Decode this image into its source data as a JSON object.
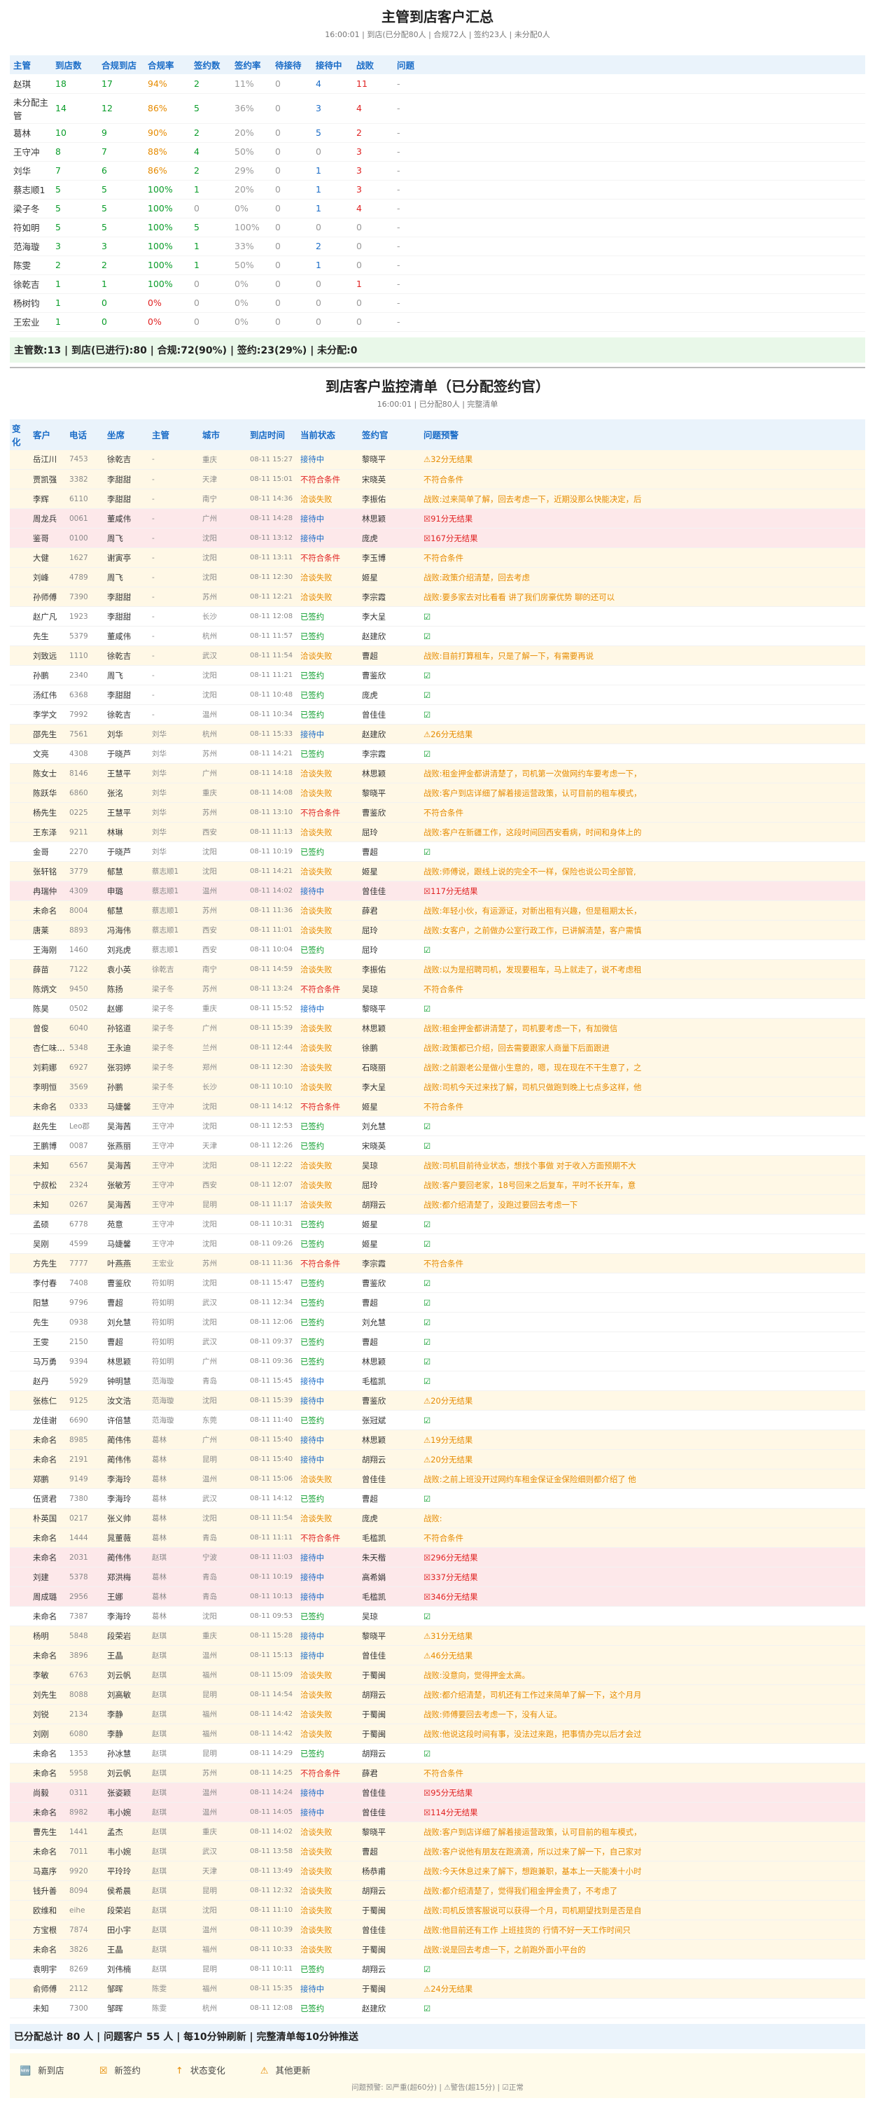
{
  "title": "主管到店客户汇总",
  "subtitle": "16:00:01 | 到店(已分配80人 | 合规72人 | 签约23人 | 未分配0人",
  "mgr_headers": [
    "主管",
    "到店数",
    "合规到店",
    "合规率",
    "签约数",
    "签约率",
    "待接待",
    "接待中",
    "战败",
    "问题"
  ],
  "managers": [
    [
      "赵琪",
      "18",
      "17",
      "94%",
      "2",
      "11%",
      "0",
      "4",
      "11",
      "-"
    ],
    [
      "未分配主管",
      "14",
      "12",
      "86%",
      "5",
      "36%",
      "0",
      "3",
      "4",
      "-"
    ],
    [
      "葛林",
      "10",
      "9",
      "90%",
      "2",
      "20%",
      "0",
      "5",
      "2",
      "-"
    ],
    [
      "王守冲",
      "8",
      "7",
      "88%",
      "4",
      "50%",
      "0",
      "0",
      "3",
      "-"
    ],
    [
      "刘华",
      "7",
      "6",
      "86%",
      "2",
      "29%",
      "0",
      "1",
      "3",
      "-"
    ],
    [
      "蔡志顺1",
      "5",
      "5",
      "100%",
      "1",
      "20%",
      "0",
      "1",
      "3",
      "-"
    ],
    [
      "梁子冬",
      "5",
      "5",
      "100%",
      "0",
      "0%",
      "0",
      "1",
      "4",
      "-"
    ],
    [
      "符如明",
      "5",
      "5",
      "100%",
      "5",
      "100%",
      "0",
      "0",
      "0",
      "-"
    ],
    [
      "范海璇",
      "3",
      "3",
      "100%",
      "1",
      "33%",
      "0",
      "2",
      "0",
      "-"
    ],
    [
      "陈雯",
      "2",
      "2",
      "100%",
      "1",
      "50%",
      "0",
      "1",
      "0",
      "-"
    ],
    [
      "徐乾吉",
      "1",
      "1",
      "100%",
      "0",
      "0%",
      "0",
      "0",
      "1",
      "-"
    ],
    [
      "杨树钧",
      "1",
      "0",
      "0%",
      "0",
      "0%",
      "0",
      "0",
      "0",
      "-"
    ],
    [
      "王宏业",
      "1",
      "0",
      "0%",
      "0",
      "0%",
      "0",
      "0",
      "0",
      "-"
    ]
  ],
  "mgr_note": "主管数:13 | 到店(已进行):80 | 合规:72(90%) | 签约:23(29%) | 未分配:0",
  "title2": "到店客户监控清单（已分配签约官）",
  "subtitle2": "16:00:01 | 已分配80人 | 完整清单",
  "mon_headers": [
    "变化",
    "客户",
    "电话",
    "坐席",
    "主管",
    "城市",
    "到店时间",
    "当前状态",
    "签约官",
    "问题预警"
  ],
  "rows": [
    [
      "岳江川",
      "7453",
      "徐乾吉",
      "-",
      "重庆",
      "08-11 15:27",
      "接待中",
      "黎晓平",
      "⚠32分无结果",
      "c"
    ],
    [
      "贾凯强",
      "3382",
      "李甜甜",
      "-",
      "天津",
      "08-11 15:01",
      "不符合条件",
      "宋晓英",
      "不符合条件",
      "c"
    ],
    [
      "李辉",
      "6110",
      "李甜甜",
      "-",
      "南宁",
      "08-11 14:36",
      "洽谈失败",
      "李振佑",
      "战败:过来简单了解，回去考虑一下，近期没那么快能决定，后",
      "c"
    ],
    [
      "周龙兵",
      "0061",
      "董咸伟",
      "-",
      "广州",
      "08-11 14:28",
      "接待中",
      "林思颖",
      "☒91分无结果",
      "r"
    ],
    [
      "鉴哥",
      "0100",
      "周飞",
      "-",
      "沈阳",
      "08-11 13:12",
      "接待中",
      "庞虎",
      "☒167分无结果",
      "r"
    ],
    [
      "大健",
      "1627",
      "谢寅亭",
      "-",
      "沈阳",
      "08-11 13:11",
      "不符合条件",
      "李玉博",
      "不符合条件",
      "c"
    ],
    [
      "刘峰",
      "4789",
      "周飞",
      "-",
      "沈阳",
      "08-11 12:30",
      "洽谈失败",
      "姬星",
      "战败:政策介绍清楚，回去考虑",
      "c"
    ],
    [
      "孙师傅",
      "7390",
      "李甜甜",
      "-",
      "苏州",
      "08-11 12:21",
      "洽谈失败",
      "李宗霞",
      "战败:要多家去对比看看 讲了我们房豪优势 聊的还可以",
      "c"
    ],
    [
      "赵广凡",
      "1923",
      "李甜甜",
      "-",
      "长沙",
      "08-11 12:08",
      "已签约",
      "李大呈",
      "☑",
      "n"
    ],
    [
      "先生",
      "5379",
      "董咸伟",
      "-",
      "杭州",
      "08-11 11:57",
      "已签约",
      "赵建欣",
      "☑",
      "n"
    ],
    [
      "刘致远",
      "1110",
      "徐乾吉",
      "-",
      "武汉",
      "08-11 11:54",
      "洽谈失败",
      "曹超",
      "战败:目前打算租车，只是了解一下，有需要再说",
      "c"
    ],
    [
      "孙鹏",
      "2340",
      "周飞",
      "-",
      "沈阳",
      "08-11 11:21",
      "已签约",
      "曹鉴欣",
      "☑",
      "n"
    ],
    [
      "汤红伟",
      "6368",
      "李甜甜",
      "-",
      "沈阳",
      "08-11 10:48",
      "已签约",
      "庞虎",
      "☑",
      "n"
    ],
    [
      "李学文",
      "7992",
      "徐乾吉",
      "-",
      "温州",
      "08-11 10:34",
      "已签约",
      "曾佳佳",
      "☑",
      "n"
    ],
    [
      "邵先生",
      "7561",
      "刘华",
      "刘华",
      "杭州",
      "08-11 15:33",
      "接待中",
      "赵建欣",
      "⚠26分无结果",
      "c"
    ],
    [
      "文亮",
      "4308",
      "于晓芦",
      "刘华",
      "苏州",
      "08-11 14:21",
      "已签约",
      "李宗霞",
      "☑",
      "n"
    ],
    [
      "陈女士",
      "8146",
      "王慧平",
      "刘华",
      "广州",
      "08-11 14:18",
      "洽谈失败",
      "林思颖",
      "战败:租金押金都讲清楚了，司机第一次做网约车要考虑一下，",
      "c"
    ],
    [
      "陈跃华",
      "6860",
      "张洺",
      "刘华",
      "重庆",
      "08-11 14:08",
      "洽谈失败",
      "黎晓平",
      "战败:客户到店详细了解着接运营政策，认可目前的租车模式，",
      "c"
    ],
    [
      "杨先生",
      "0225",
      "王慧平",
      "刘华",
      "苏州",
      "08-11 13:10",
      "不符合条件",
      "曹鉴欣",
      "不符合条件",
      "c"
    ],
    [
      "王东泽",
      "9211",
      "林琳",
      "刘华",
      "西安",
      "08-11 11:13",
      "洽谈失败",
      "屈玲",
      "战败:客户在新疆工作，这段时间回西安看病，时间和身体上的",
      "c"
    ],
    [
      "金哥",
      "2270",
      "于晓芦",
      "刘华",
      "沈阳",
      "08-11 10:19",
      "已签约",
      "曹超",
      "☑",
      "n"
    ],
    [
      "张轩铭",
      "3779",
      "郁慧",
      "蔡志顺1",
      "沈阳",
      "08-11 14:21",
      "洽谈失败",
      "姬星",
      "战败:师傅说，跟线上说的完全不一样，保险也说公司全部管,",
      "c"
    ],
    [
      "冉瑞仲",
      "4309",
      "申璐",
      "蔡志顺1",
      "温州",
      "08-11 14:02",
      "接待中",
      "曾佳佳",
      "☒117分无结果",
      "r"
    ],
    [
      "未命名",
      "8004",
      "郁慧",
      "蔡志顺1",
      "苏州",
      "08-11 11:36",
      "洽谈失败",
      "薛君",
      "战败:年轻小伙，有运源证，对新出租有兴趣，但是租期太长，",
      "c"
    ],
    [
      "唐莱",
      "8893",
      "冯海伟",
      "蔡志顺1",
      "西安",
      "08-11 11:01",
      "洽谈失败",
      "屈玲",
      "战败:女客户，之前做办公室行政工作，已讲解清楚，客户需慎",
      "c"
    ],
    [
      "王海刚",
      "1460",
      "刘兆虎",
      "蔡志顺1",
      "西安",
      "08-11 10:04",
      "已签约",
      "屈玲",
      "☑",
      "n"
    ],
    [
      "薛苗",
      "7122",
      "袁小英",
      "徐乾吉",
      "南宁",
      "08-11 14:59",
      "洽谈失败",
      "李振佑",
      "战败:以为是招聘司机，发现要租车，马上就走了，说不考虑租",
      "c"
    ],
    [
      "陈炳文",
      "9450",
      "陈扬",
      "梁子冬",
      "苏州",
      "08-11 13:24",
      "不符合条件",
      "吴琼",
      "不符合条件",
      "c"
    ],
    [
      "陈昊",
      "0502",
      "赵娜",
      "梁子冬",
      "重庆",
      "08-11 15:52",
      "接待中",
      "黎晓平",
      "☑",
      "n"
    ],
    [
      "曾俊",
      "6040",
      "孙铭道",
      "梁子冬",
      "广州",
      "08-11 15:39",
      "洽谈失败",
      "林思颖",
      "战败:租金押金都讲清楚了，司机要考虑一下，有加微信",
      "c"
    ],
    [
      "杏仁味的馨馨",
      "5348",
      "王永迪",
      "梁子冬",
      "兰州",
      "08-11 12:44",
      "洽谈失败",
      "徐鹏",
      "战败:政策都已介绍，回去需要跟家人商量下后面跟进",
      "c"
    ],
    [
      "刘莉娜",
      "6927",
      "张羽婷",
      "梁子冬",
      "郑州",
      "08-11 12:30",
      "洽谈失败",
      "石晓丽",
      "战败:之前跟老公是做小生意的，嗯，现在现在不干生意了，之",
      "c"
    ],
    [
      "李明恒",
      "3569",
      "孙鹏",
      "梁子冬",
      "长沙",
      "08-11 10:10",
      "洽谈失败",
      "李大呈",
      "战败:司机今天过来找了解，司机只做跑到晚上七点多这样，他",
      "c"
    ],
    [
      "未命名",
      "0333",
      "马婕馨",
      "王守冲",
      "沈阳",
      "08-11 14:12",
      "不符合条件",
      "姬星",
      "不符合条件",
      "c"
    ],
    [
      "赵先生",
      "Leo郡",
      "吴海茜",
      "王守冲",
      "沈阳",
      "08-11 12:53",
      "已签约",
      "刘允慧",
      "☑",
      "n"
    ],
    [
      "王鹏博",
      "0087",
      "张燕丽",
      "王守冲",
      "天津",
      "08-11 12:26",
      "已签约",
      "宋晓英",
      "☑",
      "n"
    ],
    [
      "未知",
      "6567",
      "吴海茜",
      "王守冲",
      "沈阳",
      "08-11 12:22",
      "洽谈失败",
      "吴琼",
      "战败:司机目前待业状态，想找个事做 对于收入方面预期不大",
      "c"
    ],
    [
      "宁叔松",
      "2324",
      "张敏芳",
      "王守冲",
      "西安",
      "08-11 12:07",
      "洽谈失败",
      "屈玲",
      "战败:客户要回老家，18号回来之后复车，平时不长开车，意",
      "c"
    ],
    [
      "未知",
      "0267",
      "吴海茜",
      "王守冲",
      "昆明",
      "08-11 11:17",
      "洽谈失败",
      "胡翔云",
      "战败:都介绍清楚了，没跑过要回去考虑一下",
      "c"
    ],
    [
      "孟硕",
      "6778",
      "苑意",
      "王守冲",
      "沈阳",
      "08-11 10:31",
      "已签约",
      "姬星",
      "☑",
      "n"
    ],
    [
      "吴刚",
      "4599",
      "马婕馨",
      "王守冲",
      "沈阳",
      "08-11 09:26",
      "已签约",
      "姬星",
      "☑",
      "n"
    ],
    [
      "方先生",
      "7777",
      "叶燕燕",
      "王宏业",
      "苏州",
      "08-11 11:36",
      "不符合条件",
      "李宗霞",
      "不符合条件",
      "c"
    ],
    [
      "李付春",
      "7408",
      "曹鉴欣",
      "符如明",
      "沈阳",
      "08-11 15:47",
      "已签约",
      "曹鉴欣",
      "☑",
      "n"
    ],
    [
      "阳慧",
      "9796",
      "曹超",
      "符如明",
      "武汉",
      "08-11 12:34",
      "已签约",
      "曹超",
      "☑",
      "n"
    ],
    [
      "先生",
      "0938",
      "刘允慧",
      "符如明",
      "沈阳",
      "08-11 12:06",
      "已签约",
      "刘允慧",
      "☑",
      "n"
    ],
    [
      "王雯",
      "2150",
      "曹超",
      "符如明",
      "武汉",
      "08-11 09:37",
      "已签约",
      "曹超",
      "☑",
      "n"
    ],
    [
      "马万勇",
      "9394",
      "林思颖",
      "符如明",
      "广州",
      "08-11 09:36",
      "已签约",
      "林思颖",
      "☑",
      "n"
    ],
    [
      "赵丹",
      "5929",
      "钟明慧",
      "范海璇",
      "青岛",
      "08-11 15:45",
      "接待中",
      "毛槛凯",
      "☑",
      "n"
    ],
    [
      "张栋仁",
      "9125",
      "汝文浩",
      "范海璇",
      "沈阳",
      "08-11 15:39",
      "接待中",
      "曹鉴欣",
      "⚠20分无结果",
      "c"
    ],
    [
      "龙佳谢",
      "6690",
      "许倍慧",
      "范海璇",
      "东莞",
      "08-11 11:40",
      "已签约",
      "张冠斌",
      "☑",
      "n"
    ],
    [
      "未命名",
      "8985",
      "蔺伟伟",
      "葛林",
      "广州",
      "08-11 15:40",
      "接待中",
      "林思颖",
      "⚠19分无结果",
      "c"
    ],
    [
      "未命名",
      "2191",
      "蔺伟伟",
      "葛林",
      "昆明",
      "08-11 15:40",
      "接待中",
      "胡翔云",
      "⚠20分无结果",
      "c"
    ],
    [
      "郑鹏",
      "9149",
      "李海玲",
      "葛林",
      "温州",
      "08-11 15:06",
      "洽谈失败",
      "曾佳佳",
      "战败:之前上班没开过网约车租金保证金保险细则都介绍了 他",
      "c"
    ],
    [
      "伍贤君",
      "7380",
      "李海玲",
      "葛林",
      "武汉",
      "08-11 14:12",
      "已签约",
      "曹超",
      "☑",
      "n"
    ],
    [
      "朴英国",
      "0217",
      "张义帅",
      "葛林",
      "沈阳",
      "08-11 11:54",
      "洽谈失败",
      "庞虎",
      "战败:",
      "c"
    ],
    [
      "未命名",
      "1444",
      "晁董薇",
      "葛林",
      "青岛",
      "08-11 11:11",
      "不符合条件",
      "毛槛凯",
      "不符合条件",
      "c"
    ],
    [
      "未命名",
      "2031",
      "蔺伟伟",
      "赵琪",
      "宁波",
      "08-11 11:03",
      "接待中",
      "朱天楷",
      "☒296分无结果",
      "r"
    ],
    [
      "刘建",
      "5378",
      "郑洪梅",
      "葛林",
      "青岛",
      "08-11 10:19",
      "接待中",
      "高希娟",
      "☒337分无结果",
      "r"
    ],
    [
      "周成璐",
      "2956",
      "王娜",
      "葛林",
      "青岛",
      "08-11 10:13",
      "接待中",
      "毛槛凯",
      "☒346分无结果",
      "r"
    ],
    [
      "未命名",
      "7387",
      "李海玲",
      "葛林",
      "沈阳",
      "08-11 09:53",
      "已签约",
      "吴琼",
      "☑",
      "n"
    ],
    [
      "杨明",
      "5848",
      "段荣岩",
      "赵琪",
      "重庆",
      "08-11 15:28",
      "接待中",
      "黎晓平",
      "⚠31分无结果",
      "c"
    ],
    [
      "未命名",
      "3896",
      "王晶",
      "赵琪",
      "温州",
      "08-11 15:13",
      "接待中",
      "曾佳佳",
      "⚠46分无结果",
      "c"
    ],
    [
      "李敏",
      "6763",
      "刘云帆",
      "赵琪",
      "福州",
      "08-11 15:09",
      "洽谈失败",
      "于蜀闽",
      "战败:没意向，觉得押金太高。",
      "c"
    ],
    [
      "刘先生",
      "8088",
      "刘高敏",
      "赵琪",
      "昆明",
      "08-11 14:54",
      "洽谈失败",
      "胡翔云",
      "战败:都介绍清楚，司机还有工作过来简单了解一下，这个月月",
      "c"
    ],
    [
      "刘锐",
      "2134",
      "李静",
      "赵琪",
      "福州",
      "08-11 14:42",
      "洽谈失败",
      "于蜀闽",
      "战败:师傅要回去考虑一下，没有人证。",
      "c"
    ],
    [
      "刘刚",
      "6080",
      "李静",
      "赵琪",
      "福州",
      "08-11 14:42",
      "洽谈失败",
      "于蜀闽",
      "战败:他说这段时间有事，没法过来跑，把事情办完以后才会过",
      "c"
    ],
    [
      "未命名",
      "1353",
      "孙冰慧",
      "赵琪",
      "昆明",
      "08-11 14:29",
      "已签约",
      "胡翔云",
      "☑",
      "n"
    ],
    [
      "未命名",
      "5958",
      "刘云帆",
      "赵琪",
      "苏州",
      "08-11 14:25",
      "不符合条件",
      "薛君",
      "不符合条件",
      "c"
    ],
    [
      "尚毅",
      "0311",
      "张姿颖",
      "赵琪",
      "温州",
      "08-11 14:24",
      "接待中",
      "曾佳佳",
      "☒95分无结果",
      "r"
    ],
    [
      "未命名",
      "8982",
      "韦小婉",
      "赵琪",
      "温州",
      "08-11 14:05",
      "接待中",
      "曾佳佳",
      "☒114分无结果",
      "r"
    ],
    [
      "曹先生",
      "1441",
      "孟杰",
      "赵琪",
      "重庆",
      "08-11 14:02",
      "洽谈失败",
      "黎晓平",
      "战败:客户到店详细了解着接运营政策，认可目前的租车模式，",
      "c"
    ],
    [
      "未命名",
      "7011",
      "韦小婉",
      "赵琪",
      "武汉",
      "08-11 13:58",
      "洽谈失败",
      "曹超",
      "战败:客户说他有朋友在跑滴滴，所以过来了解一下，自己家对",
      "c"
    ],
    [
      "马嘉序",
      "9920",
      "平玲玲",
      "赵琪",
      "天津",
      "08-11 13:49",
      "洽谈失败",
      "杨恭甫",
      "战败:今天休息过来了解下，想跑兼职，基本上一天能凑十小时",
      "c"
    ],
    [
      "钱升善",
      "8094",
      "侯希晨",
      "赵琪",
      "昆明",
      "08-11 12:32",
      "洽谈失败",
      "胡翔云",
      "战败:都介绍清楚了，觉得我们租金押金贵了，不考虑了",
      "c"
    ],
    [
      "欧维和",
      "eihe",
      "段荣岩",
      "赵琪",
      "沈阳",
      "08-11 11:10",
      "洽谈失败",
      "于蜀闽",
      "战败:司机反馈客服说可以获得一个月，司机期望找到是否是自",
      "c"
    ],
    [
      "方宝根",
      "7874",
      "田小宇",
      "赵琪",
      "温州",
      "08-11 10:39",
      "洽谈失败",
      "曾佳佳",
      "战败:他目前还有工作 上班挂货的 行情不好一天工作时间只",
      "c"
    ],
    [
      "未命名",
      "3826",
      "王晶",
      "赵琪",
      "福州",
      "08-11 10:33",
      "洽谈失败",
      "于蜀闽",
      "战败:说是回去考虑一下，之前跑外面小平台的",
      "c"
    ],
    [
      "袁明宇",
      "8269",
      "刘伟楠",
      "赵琪",
      "昆明",
      "08-11 10:11",
      "已签约",
      "胡翔云",
      "☑",
      "n"
    ],
    [
      "俞师傅",
      "2112",
      "邹晖",
      "陈雯",
      "福州",
      "08-11 15:35",
      "接待中",
      "于蜀闽",
      "⚠24分无结果",
      "c"
    ],
    [
      "未知",
      "7300",
      "邹晖",
      "陈雯",
      "杭州",
      "08-11 12:08",
      "已签约",
      "赵建欣",
      "☑",
      "n"
    ]
  ],
  "summary": "已分配总计 80 人 | 问题客户 55 人 | 每10分钟刷新 | 完整清单每10分钟推送",
  "legend": [
    {
      "icon": "🆕",
      "label": "新到店"
    },
    {
      "icon": "☒",
      "label": "新签约"
    },
    {
      "icon": "↑",
      "label": "状态变化"
    },
    {
      "icon": "⚠",
      "label": "其他更新"
    }
  ],
  "footer": "问题预警: ☒严重(超60分) | ⚠警告(超15分) | ☑正常",
  "colors": {
    "green": "#0a9d2a",
    "orange": "#e68b00",
    "red": "#e02222",
    "blue": "#1a6cc7"
  }
}
